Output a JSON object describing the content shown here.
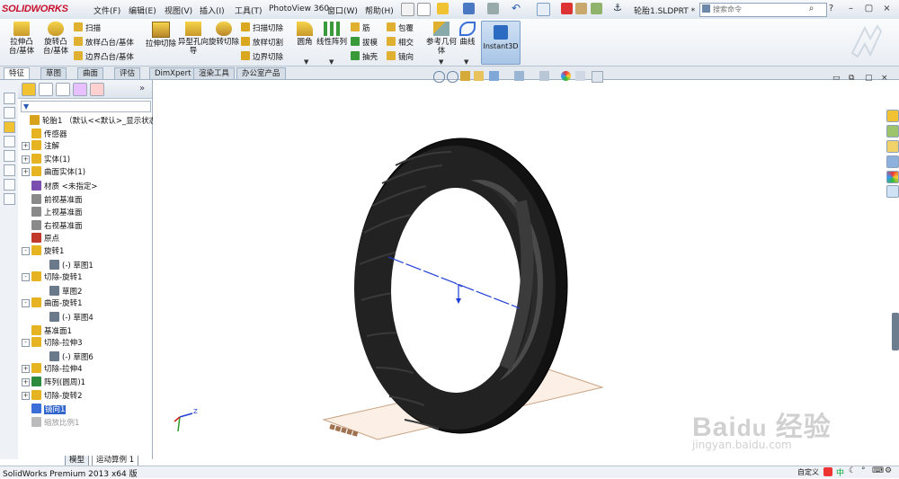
{
  "app": {
    "logo": "SOLIDWORKS",
    "doc_title": "轮胎1.SLDPRT *"
  },
  "menu": [
    "文件(F)",
    "编辑(E)",
    "视图(V)",
    "插入(I)",
    "工具(T)",
    "PhotoView 360",
    "窗口(W)",
    "帮助(H)"
  ],
  "search": {
    "placeholder": "搜索命令"
  },
  "commands": {
    "extrude_boss": "拉伸凸台/基体",
    "revolve_boss": "旋转凸台/基体",
    "sweep": "扫描",
    "loft": "放样凸台/基体",
    "boundary_boss": "边界凸台/基体",
    "extrude_cut": "拉伸切除",
    "hole_wizard": "异型孔向导",
    "revolve_cut": "旋转切除",
    "sweep_cut": "扫描切除",
    "loft_cut": "放样切割",
    "boundary_cut": "边界切除",
    "fillet": "圆角",
    "linear_pattern": "线性阵列",
    "rib": "筋",
    "draft": "拔模",
    "shell": "抽壳",
    "wrap": "包覆",
    "intersect": "相交",
    "mirror": "镜向",
    "reference_geometry": "参考几何体",
    "curves": "曲线",
    "instant3d": "Instant3D"
  },
  "tabs": [
    "特征",
    "草图",
    "曲面",
    "评估",
    "DimXpert",
    "渲染工具",
    "办公室产品"
  ],
  "feature_tree": [
    {
      "label": "轮胎1 （默认<<默认>_显示状态",
      "level": 0,
      "icon": "part-icon",
      "color": "#d9a21b",
      "exp": ""
    },
    {
      "label": "传感器",
      "level": 1,
      "icon": "sensor-icon",
      "color": "#e6b422",
      "exp": ""
    },
    {
      "label": "注解",
      "level": 1,
      "icon": "annotation-icon",
      "color": "#e6b422",
      "exp": "+"
    },
    {
      "label": "实体(1)",
      "level": 1,
      "icon": "solid-bodies-icon",
      "color": "#e6b422",
      "exp": "+"
    },
    {
      "label": "曲面实体(1)",
      "level": 1,
      "icon": "surface-bodies-icon",
      "color": "#e6b422",
      "exp": "+"
    },
    {
      "label": "材质 <未指定>",
      "level": 1,
      "icon": "material-icon",
      "color": "#7a4fb0",
      "exp": ""
    },
    {
      "label": "前视基准面",
      "level": 1,
      "icon": "plane-icon",
      "color": "#8a8a8a",
      "exp": ""
    },
    {
      "label": "上视基准面",
      "level": 1,
      "icon": "plane-icon",
      "color": "#8a8a8a",
      "exp": ""
    },
    {
      "label": "右视基准面",
      "level": 1,
      "icon": "plane-icon",
      "color": "#8a8a8a",
      "exp": ""
    },
    {
      "label": "原点",
      "level": 1,
      "icon": "origin-icon",
      "color": "#c0392b",
      "exp": ""
    },
    {
      "label": "旋转1",
      "level": 1,
      "icon": "revolve-icon",
      "color": "#e6b422",
      "exp": "-"
    },
    {
      "label": "(-) 草图1",
      "level": 2,
      "icon": "sketch-icon",
      "color": "#6b7a8a",
      "exp": ""
    },
    {
      "label": "切除-旋转1",
      "level": 1,
      "icon": "cut-revolve-icon",
      "color": "#e6b422",
      "exp": "-"
    },
    {
      "label": "草图2",
      "level": 2,
      "icon": "sketch-icon",
      "color": "#6b7a8a",
      "exp": ""
    },
    {
      "label": "曲面-旋转1",
      "level": 1,
      "icon": "surface-revolve-icon",
      "color": "#e6b422",
      "exp": "-"
    },
    {
      "label": "(-) 草图4",
      "level": 2,
      "icon": "sketch-icon",
      "color": "#6b7a8a",
      "exp": ""
    },
    {
      "label": "基准面1",
      "level": 1,
      "icon": "plane-icon",
      "color": "#e6b422",
      "exp": ""
    },
    {
      "label": "切除-拉伸3",
      "level": 1,
      "icon": "cut-extrude-icon",
      "color": "#e6b422",
      "exp": "-"
    },
    {
      "label": "(-) 草图6",
      "level": 2,
      "icon": "sketch-icon",
      "color": "#6b7a8a",
      "exp": ""
    },
    {
      "label": "切除-拉伸4",
      "level": 1,
      "icon": "cut-extrude-icon",
      "color": "#e6b422",
      "exp": "+"
    },
    {
      "label": "阵列(圆周)1",
      "level": 1,
      "icon": "circular-pattern-icon",
      "color": "#2e8b3d",
      "exp": "+"
    },
    {
      "label": "切除-旋转2",
      "level": 1,
      "icon": "cut-revolve-icon",
      "color": "#e6b422",
      "exp": "+"
    },
    {
      "label": "镜向1",
      "level": 1,
      "icon": "mirror-icon",
      "color": "#3a6fd8",
      "exp": "",
      "selected": true
    },
    {
      "label": "缩放比例1",
      "level": 1,
      "icon": "scale-icon",
      "color": "#bbbbbb",
      "exp": "",
      "dim": true
    }
  ],
  "bottom_tabs": [
    "模型",
    "运动算例 1"
  ],
  "status": {
    "left": "SolidWorks Premium 2013 x64 版",
    "right": "自定义"
  },
  "colors": {
    "selection_blue": "#3366cc",
    "axis_blue": "#1f3fd6",
    "tire_black": "#1a1a1a"
  }
}
